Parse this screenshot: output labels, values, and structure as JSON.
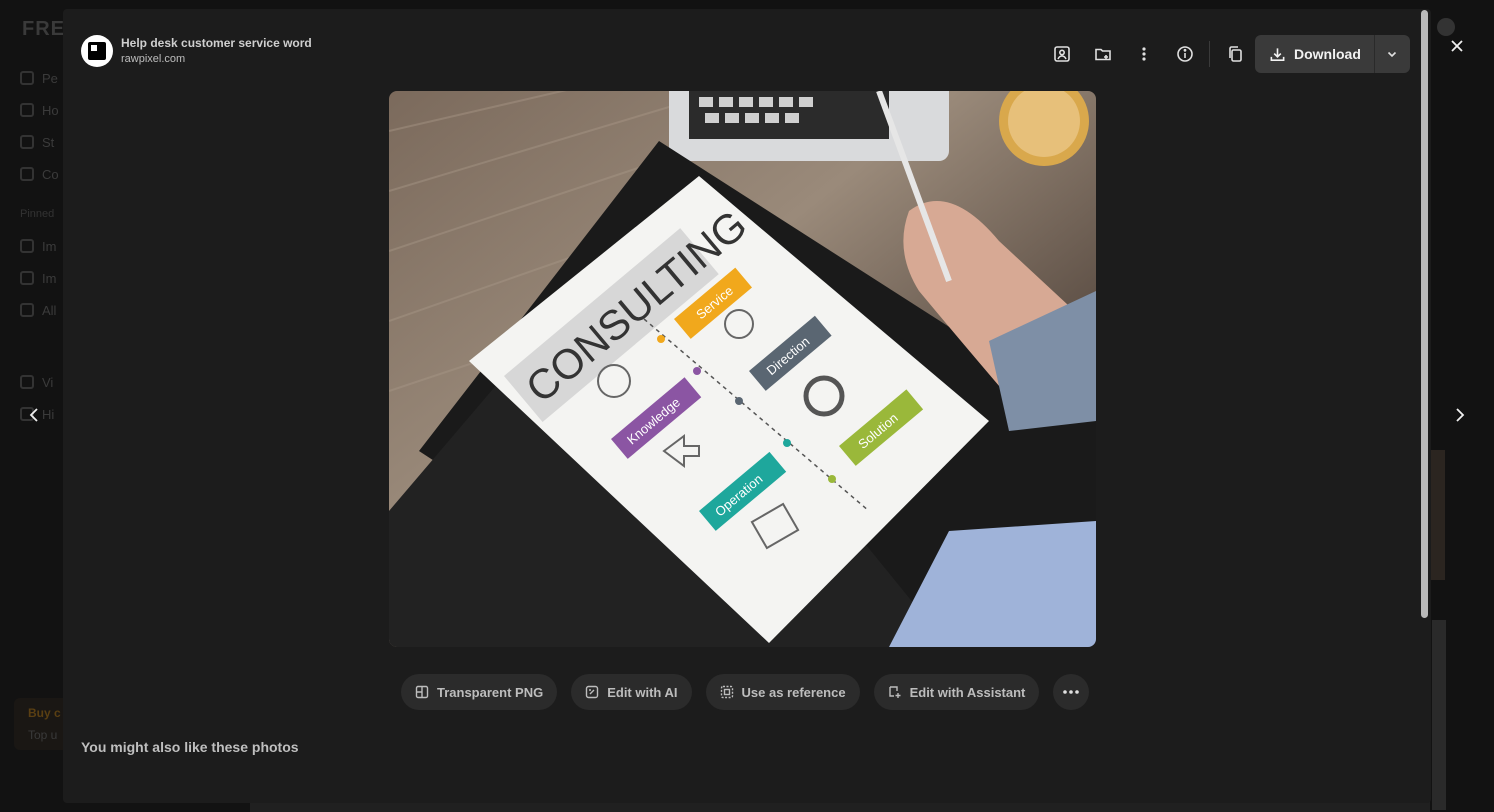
{
  "background": {
    "logo": "FREE",
    "nav_labels": [
      "Pe",
      "Ho",
      "St",
      "Co"
    ],
    "pinned_heading": "Pinned",
    "pinned_items": [
      "Im",
      "Im",
      "All"
    ],
    "more_items": [
      "Vi",
      "Hi"
    ],
    "buy_title": "Buy c",
    "buy_sub": "Top u"
  },
  "photo_meta": {
    "title": "Help desk customer service word",
    "source": "rawpixel.com"
  },
  "toolbar": {
    "icons": [
      "user-image-icon",
      "folder-add-icon",
      "more-vertical-icon",
      "info-icon",
      "copy-icon"
    ],
    "download_label": "Download"
  },
  "image": {
    "paper_heading": "CONSULTING",
    "labels": [
      "Service",
      "Direction",
      "Knowledge",
      "Solution",
      "Operation"
    ],
    "colors": {
      "service": "#f1a81c",
      "direction": "#5a6672",
      "knowledge": "#8b55a3",
      "solution": "#9ab83a",
      "operation": "#1ea79c"
    }
  },
  "actions": [
    {
      "label": "Transparent PNG",
      "icon": "transparent-png-icon"
    },
    {
      "label": "Edit with AI",
      "icon": "ai-edit-icon"
    },
    {
      "label": "Use as reference",
      "icon": "reference-icon"
    },
    {
      "label": "Edit with Assistant",
      "icon": "assistant-icon"
    }
  ],
  "similar_heading": "You might also like these photos"
}
